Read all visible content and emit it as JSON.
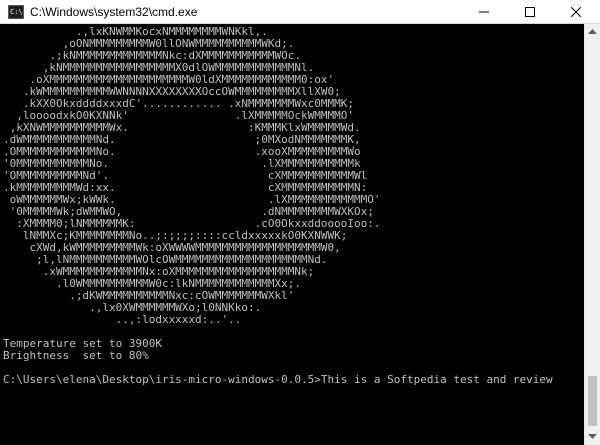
{
  "window": {
    "title": "C:\\Windows\\system32\\cmd.exe",
    "icon_name": "command-prompt-icon",
    "controls": {
      "minimize_icon": "minimize-icon",
      "maximize_icon": "maximize-icon",
      "close_icon": "close-icon"
    }
  },
  "console": {
    "foreground_color": "#c0c0c0",
    "background_color": "#000000",
    "lines": [
      "           .,lxKNWMMKocxNMMMMMMMMWNKkl,.",
      "         ,oONMMMMMMMMMW0llONWMMMMMMMMMMWKd;.",
      "       .;kNMMMMMMMMMMMMMNkc:dXMMMMMMMMMMMWOc.",
      "      ,kNMMMMMMMMMMMMMMMMMX0dlOWMMMMMMMMMMMMNl.",
      "    .oXMMMMMMMMMMMMMMMMMMMMMW0ldXMMMMMMMMMMMM0:ox'",
      "   .kWMMMMMMMMMMWWNNNNXXXXXXXXOccOWMMMMMMMMMXllXW0;",
      "   .kXX0OkxddddxxxdC'............ .xNMMMMMMMWxc0MMMK;",
      "  ,loooodxkO0KXNNk'                .lXMMMMMOckWMMMMO'",
      " ,kXNWMMMMMMMMMMWx.                  :KMMMKlxWMMMMMWd.",
      ".dWMMMMMMMMMMMNd.                     ;0MXodNMMMMMMMK,",
      ".OMMMMMMMMMMMMNo.                     .xooXMMMMMMMMMWo",
      "'0MMMMMMMMMMMNo.                       .lXMMMMMMMMMMMk",
      "'OMMMMMMMMMMNd'.                        cXMMMMMMMMMMMWl",
      ".kMMMMMMMMMWd:xx.                       cXMMMMMMMMMMMN:",
      " oWMMMMMMWx;kWWk.                       .lXMMMMMMMMMMMMO'",
      " '0MMMMMWk;dWMMWO,                     .dNMMMMMMMMWXKOx;",
      "  :XMMMM0;lNMMMMMMK:                  .cO0OkxxddooooIoo:.",
      "   lNMMXc;KMMMMMMMMNo..;:;;;;::::ccldxxxxxkO0KXNWWK;",
      "    cXWd,kWMMMMMMMMMWk:oXWWWWMMMMMMMMMMMMMMMMMMMW0,",
      "     ;l,lNMMMMMMMMMMWOlcOWMMMMMMMMMMMMMMMMMMMMNd.",
      "      .xWMMMMMMMMMMMMNx:oXMMMMMMMMMMMMMMMMMMNk;",
      "        .l0WMMMMMMMMMMW0c:lkNMMMMMMMMMMMMXx;.",
      "          .;dKWMMMMMMMMMMNxc:cOWMMMMMMMWXkl'",
      "             .,lx0XWMMMMMMWXo;l0NNKko:.",
      "                 ..,:lodxxxxxd:..'..",
      "",
      "Temperature set to 3900K",
      "Brightness  set to 80%",
      "",
      "C:\\Users\\elena\\Desktop\\iris-micro-windows-0.0.5>This is a Softpedia test and review"
    ]
  }
}
